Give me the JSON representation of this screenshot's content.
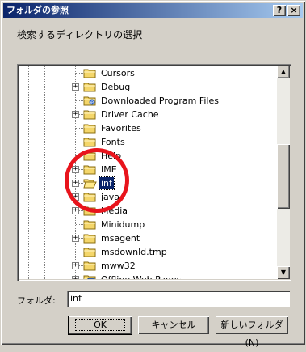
{
  "window": {
    "title": "フォルダの参照",
    "help_glyph": "?",
    "close_glyph": "×"
  },
  "instruction": "検索するディレクトリの選択",
  "colors": {
    "titlebar_start": "#0a246a",
    "titlebar_end": "#a6caf0",
    "folder": "#f4d66a",
    "selection": "#0a246a",
    "annotation_circle": "#e8141c"
  },
  "tree": {
    "items": [
      {
        "label": "Cursors",
        "expander": "",
        "icon": "folder-icon"
      },
      {
        "label": "Debug",
        "expander": "+",
        "icon": "folder-icon"
      },
      {
        "label": "Downloaded Program Files",
        "expander": "",
        "icon": "ie-folder-icon"
      },
      {
        "label": "Driver Cache",
        "expander": "+",
        "icon": "folder-icon"
      },
      {
        "label": "Favorites",
        "expander": "",
        "icon": "folder-icon"
      },
      {
        "label": "Fonts",
        "expander": "",
        "icon": "folder-icon"
      },
      {
        "label": "Help",
        "expander": "",
        "icon": "folder-icon"
      },
      {
        "label": "IME",
        "expander": "+",
        "icon": "folder-icon"
      },
      {
        "label": "inf",
        "expander": "+",
        "icon": "open-folder-icon",
        "selected": true
      },
      {
        "label": "java",
        "expander": "+",
        "icon": "folder-icon"
      },
      {
        "label": "Media",
        "expander": "+",
        "icon": "folder-icon"
      },
      {
        "label": "Minidump",
        "expander": "",
        "icon": "folder-icon"
      },
      {
        "label": "msagent",
        "expander": "+",
        "icon": "folder-icon"
      },
      {
        "label": "msdownld.tmp",
        "expander": "",
        "icon": "folder-icon"
      },
      {
        "label": "mww32",
        "expander": "+",
        "icon": "folder-icon"
      },
      {
        "label": "Offline Web Pages",
        "expander": "+",
        "icon": "offline-folder-icon"
      }
    ]
  },
  "scrollbar": {
    "up_glyph": "▲",
    "down_glyph": "▼"
  },
  "folder_field": {
    "label": "フォルダ:",
    "value": "inf"
  },
  "buttons": {
    "ok": "OK",
    "cancel": "キャンセル",
    "new_folder": "新しいフォルダ(N)"
  }
}
